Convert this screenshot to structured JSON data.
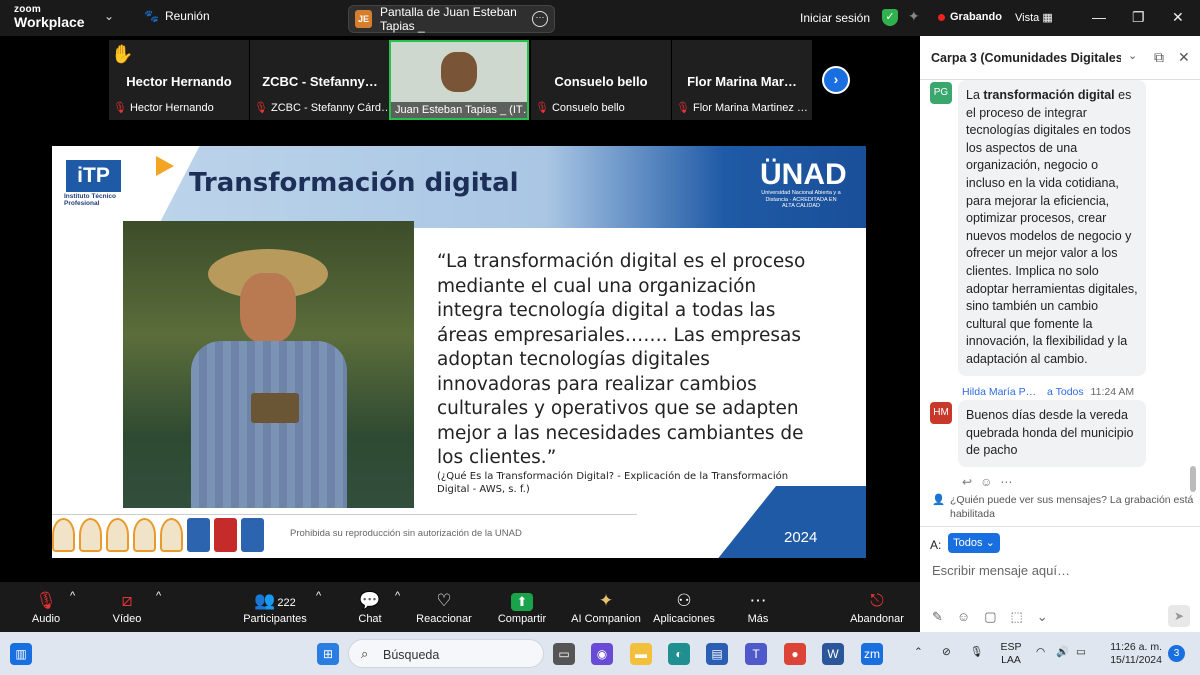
{
  "app": {
    "logo_line1": "zoom",
    "logo_line2": "Workplace",
    "meeting_label": "Reunión",
    "share_avatar": "JE",
    "share_title": "Pantalla de Juan Esteban Tapias _",
    "signin": "Iniciar sesión",
    "recording": "Grabando",
    "view": "Vista"
  },
  "participants": [
    {
      "tile_name": "Hector Hernando",
      "sub_name": "Hector Hernando"
    },
    {
      "tile_name": "ZCBC - Stefanny…",
      "sub_name": "ZCBC - Stefanny Cárd…"
    },
    {
      "tile_name": "",
      "sub_name": "Juan Esteban Tapias _ (IT…"
    },
    {
      "tile_name": "Consuelo bello",
      "sub_name": "Consuelo bello"
    },
    {
      "tile_name": "Flor Marina Mar…",
      "sub_name": "Flor Marina Martinez …"
    }
  ],
  "slide": {
    "logo": "iTP",
    "logo_sub": "Instituto Técnico Profesional",
    "title": "Transformación digital",
    "unad_logo": "ÜNAD",
    "unad_sub": "Universidad Nacional Abierta y a Distancia · ACREDITADA EN ALTA CALIDAD",
    "quote": "“La transformación digital es el proceso mediante el cual una organización integra tecnología digital a todas las áreas empresariales……. Las empresas adoptan tecnologías digitales innovadoras para realizar cambios culturales y operativos que se adapten mejor a las necesidades cambiantes de los clientes.”",
    "citation": "(¿Qué Es la Transformación Digital? - Explicación de la Transformación Digital - AWS, s. f.)",
    "footer_text": "Prohibida su reproducción sin autorización de la UNAD",
    "year": "2024"
  },
  "chat": {
    "title": "Carpa 3 (Comunidades Digitales …",
    "messages": [
      {
        "initials": "PG",
        "avatar_color": "#3aa76d",
        "text_before": "La ",
        "text_bold": "transformación digital",
        "text_after": " es el proceso de integrar tecnologías digitales en todos los aspectos de una organización, negocio o incluso en la vida cotidiana, para mejorar la eficiencia, optimizar procesos, crear nuevos modelos de negocio y ofrecer un mejor valor a los clientes. Implica no solo adoptar herramientas digitales, sino también un cambio cultural que fomente la innovación, la flexibilidad y la adaptación al cambio."
      },
      {
        "initials": "HM",
        "avatar_color": "#c8392b",
        "sender": "Hilda María P…",
        "recipient": "a Todos",
        "time": "11:24 AM",
        "text": "Buenos días desde la vereda quebrada honda del municipio de pacho"
      }
    ],
    "notice": "¿Quién puede ver sus mensajes? La grabación está habilitada",
    "to_label": "A:",
    "to_value": "Todos",
    "input_placeholder": "Escribir mensaje aquí…"
  },
  "toolbar": {
    "audio": "Audio",
    "video": "Vídeo",
    "participants": "Participantes",
    "participants_count": "222",
    "chat": "Chat",
    "reactions": "Reaccionar",
    "share": "Compartir",
    "ai": "AI Companion",
    "apps": "Aplicaciones",
    "more": "Más",
    "leave": "Abandonar"
  },
  "taskbar": {
    "search": "Búsqueda",
    "lang_line1": "ESP",
    "lang_line2": "LAA",
    "time": "11:26 a. m.",
    "date": "15/11/2024",
    "notifications": "3"
  },
  "colors": {
    "accent": "#1a6fe0",
    "share_green": "#19a34a",
    "record_red": "#e22222",
    "slide_blue": "#1f5aa6"
  }
}
